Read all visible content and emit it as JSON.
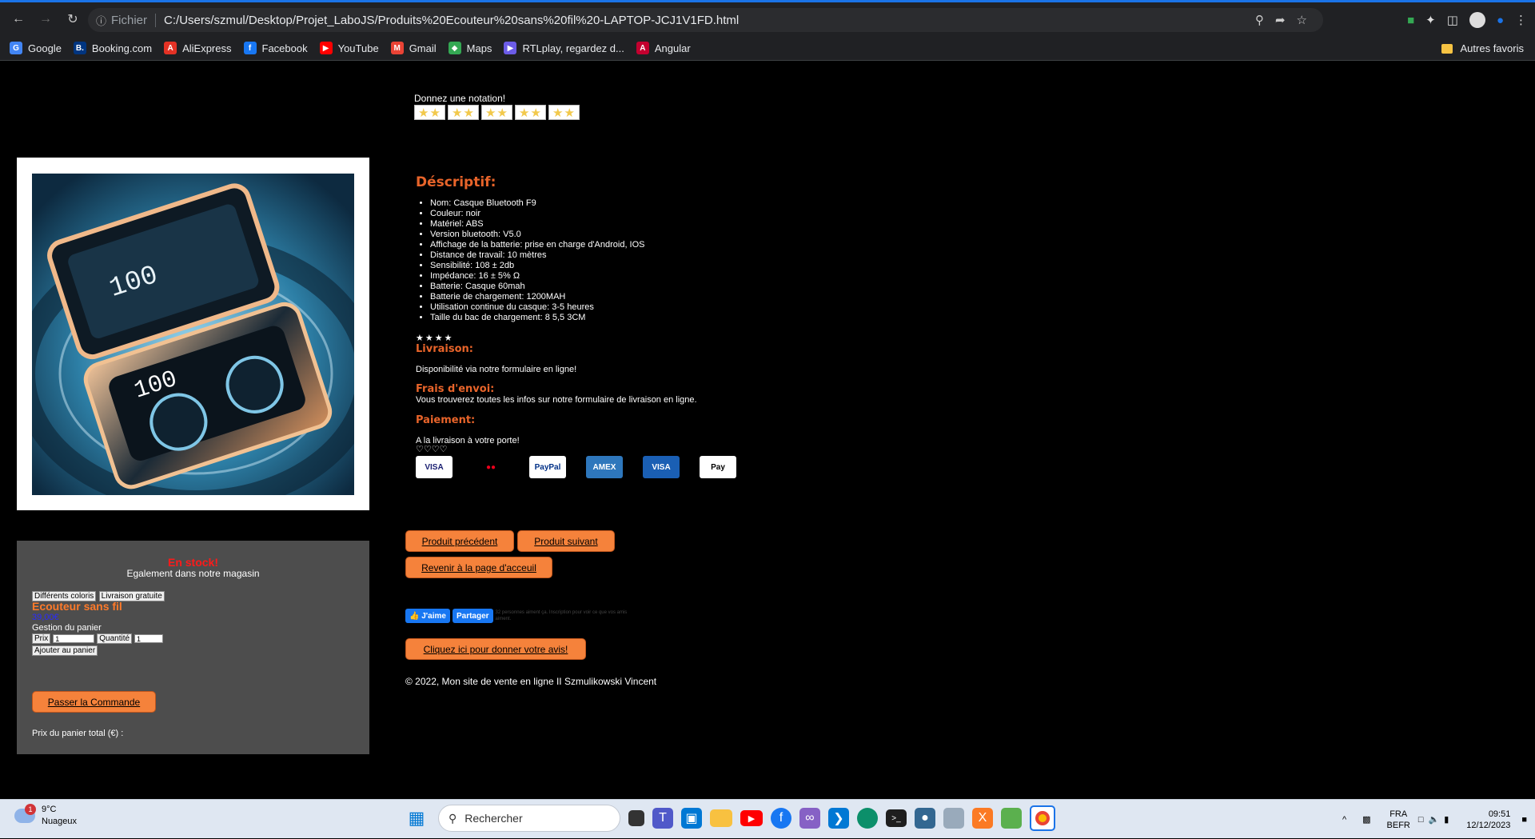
{
  "browser": {
    "scheme_label": "Fichier",
    "url": "C:/Users/szmul/Desktop/Projet_LaboJS/Produits%20Ecouteur%20sans%20fil%20-LAPTOP-JCJ1V1FD.html",
    "bookmarks": [
      {
        "label": "Google",
        "icon": "google-icon",
        "color": "#4285f4",
        "glyph": "G"
      },
      {
        "label": "Booking.com",
        "icon": "booking-icon",
        "color": "#003580",
        "glyph": "B."
      },
      {
        "label": "AliExpress",
        "icon": "aliexpress-icon",
        "color": "#e43225",
        "glyph": "A"
      },
      {
        "label": "Facebook",
        "icon": "facebook-icon",
        "color": "#1877f2",
        "glyph": "f"
      },
      {
        "label": "YouTube",
        "icon": "youtube-icon",
        "color": "#ff0000",
        "glyph": "▶"
      },
      {
        "label": "Gmail",
        "icon": "gmail-icon",
        "color": "#ea4335",
        "glyph": "M"
      },
      {
        "label": "Maps",
        "icon": "maps-icon",
        "color": "#34a853",
        "glyph": "◆"
      },
      {
        "label": "RTLplay, regardez d...",
        "icon": "rtlplay-icon",
        "color": "#6c5ce7",
        "glyph": "▶"
      },
      {
        "label": "Angular",
        "icon": "angular-icon",
        "color": "#c3002f",
        "glyph": "A"
      }
    ],
    "other_bookmarks": "Autres favoris"
  },
  "page": {
    "rating_label": "Donnez une notation!",
    "rating_stars": [
      "★★",
      "★★",
      "★★",
      "★★",
      "★★"
    ],
    "description_title": "Déscriptif:",
    "specs": [
      "Nom: Casque Bluetooth F9",
      "Couleur: noir",
      "Matériel: ABS",
      "Version bluetooth: V5.0",
      "Affichage de la batterie: prise en charge d'Android, IOS",
      "Distance de travail: 10 mètres",
      "Sensibilité: 108 ± 2db",
      "Impédance: 16 ± 5% Ω",
      "Batterie: Casque 60mah",
      "Batterie de chargement: 1200MAH",
      "Utilisation continue du casque: 3-5 heures",
      "Taille du bac de chargement: 8 5,5 3CM"
    ],
    "stars_small": "★★★★",
    "delivery_title": "Livraison:",
    "delivery_text": "Disponibilité via notre formulaire en ligne!",
    "shipping_title": "Frais d'envoi:",
    "shipping_text": "Vous trouverez toutes les infos sur notre formulaire de livraison en ligne.",
    "payment_title": "Paiement:",
    "payment_text": "A la livraison à votre porte!",
    "hearts": "♡♡♡♡",
    "payment_methods": [
      {
        "label": "VISA",
        "bg": "#ffffff",
        "fg": "#1a1f71"
      },
      {
        "label": "●●",
        "bg": "#000000",
        "fg": "#eb001b"
      },
      {
        "label": "PayPal",
        "bg": "#ffffff",
        "fg": "#003087"
      },
      {
        "label": "AMEX",
        "bg": "#2e77bc",
        "fg": "#ffffff"
      },
      {
        "label": "VISA",
        "bg": "#1a5fb4",
        "fg": "#ffffff"
      },
      {
        "label": "Pay",
        "bg": "#ffffff",
        "fg": "#000000"
      }
    ],
    "stock": {
      "status": "En stock!",
      "also_in_store": "Egalement dans notre magasin",
      "tag_colors": "Différents coloris",
      "tag_delivery": "Livraison gratuite",
      "product_name": "Ecouteur sans fil",
      "price": "39,00€",
      "cart_title": "Gestion du panier",
      "price_label": "Prix",
      "price_value": "1",
      "qty_label": "Quantité",
      "qty_value": "1",
      "add_to_cart": "Ajouter au panier",
      "order_button": "Passer la Commande",
      "cart_total": "Prix du panier total (€) :"
    },
    "prev_product": "Produit précédent",
    "next_product": "Produit suivant",
    "back_home": "Revenir à la page d'acceuil",
    "fb_like": "👍 J'aime",
    "fb_share": "Partager",
    "fb_small": "32 personnes aiment ça. Inscription pour voir ce que vos amis aiment.",
    "review_button": "Cliquez ici pour donner votre avis!",
    "footer": "© 2022, Mon site de vente en ligne II Szmulikowski Vincent"
  },
  "taskbar": {
    "temp": "9°C",
    "weather": "Nuageux",
    "weather_badge": "1",
    "search_placeholder": "Rechercher",
    "lang1": "FRA",
    "lang2": "BEFR",
    "time": "09:51",
    "date": "12/12/2023"
  }
}
